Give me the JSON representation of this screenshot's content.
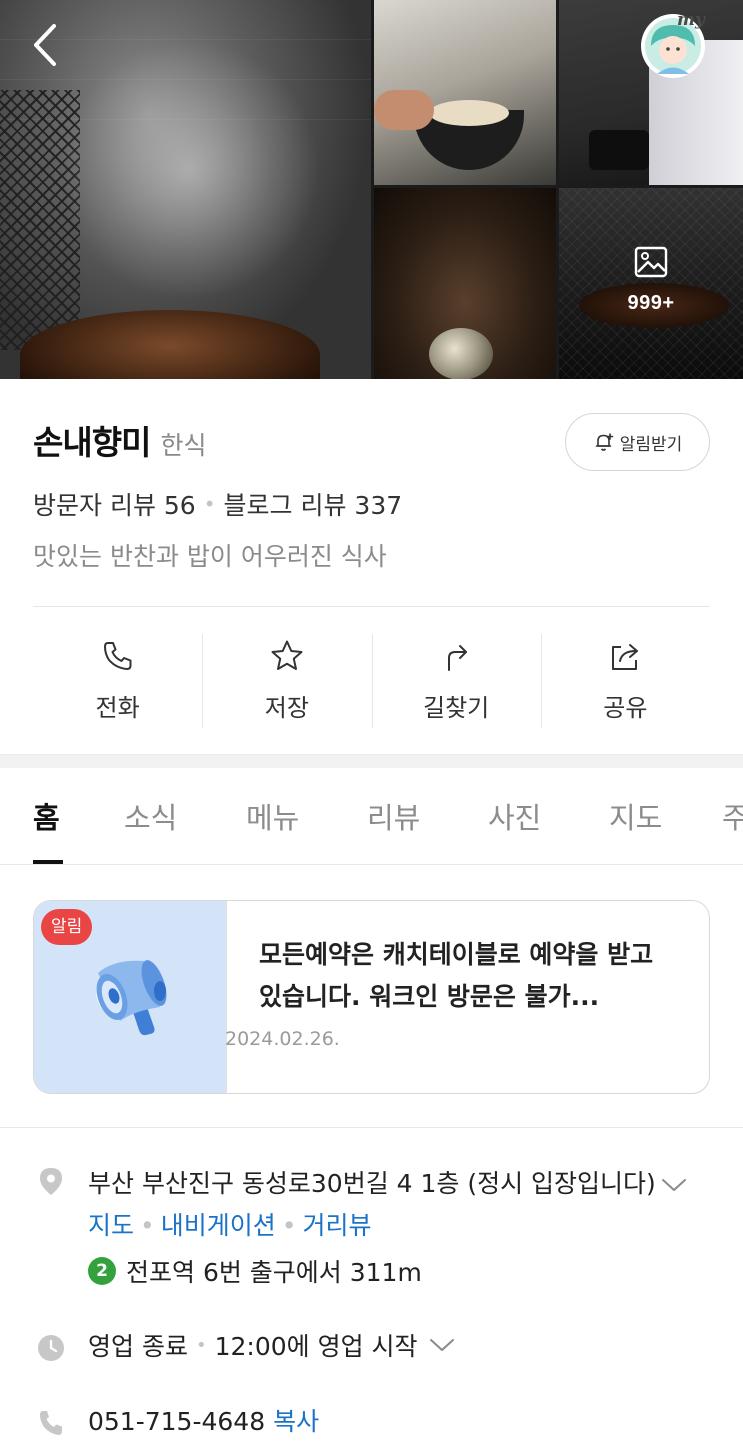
{
  "gallery": {
    "more_count": "999+"
  },
  "place": {
    "name": "손내향미",
    "category": "한식",
    "notify_label": "알림받기",
    "visitor_reviews": "방문자 리뷰 56",
    "blog_reviews": "블로그 리뷰 337",
    "description": "맛있는 반찬과 밥이 어우러진 식사"
  },
  "actions": [
    {
      "label": "전화",
      "icon": "phone-icon"
    },
    {
      "label": "저장",
      "icon": "star-icon"
    },
    {
      "label": "길찾기",
      "icon": "directions-icon"
    },
    {
      "label": "공유",
      "icon": "share-icon"
    }
  ],
  "tabs": [
    "홈",
    "소식",
    "메뉴",
    "리뷰",
    "사진",
    "지도",
    "주"
  ],
  "notice": {
    "badge": "알림",
    "text": "모든예약은 캐치테이블로 예약을 받고 있습니다. 워크인 방문은 불가...",
    "date": "2024.02.26."
  },
  "info": {
    "address": "부산 부산진구 동성로30번길 4 1층 (정시 입장입니다)",
    "map_link": "지도",
    "navigation_link": "내비게이션",
    "street_view_link": "거리뷰",
    "subway_line": "2",
    "subway_text": "전포역 6번 출구에서 311m",
    "status": "영업 종료",
    "next_open": "12:00에 영업 시작",
    "phone": "051-715-4648",
    "copy_label": "복사"
  },
  "colors": {
    "link": "#1a73c9",
    "badge_red": "#e94545",
    "subway_line2": "#33a23d"
  }
}
